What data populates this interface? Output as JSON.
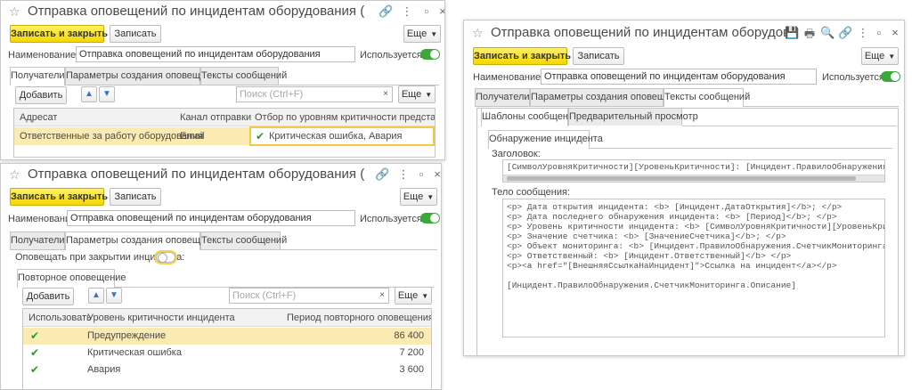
{
  "win1": {
    "title": "Отправка оповещений по инцидентам оборудования (Настройк...",
    "save_close": "Записать и закрыть",
    "save": "Записать",
    "more": "Еще",
    "name_label": "Наименование:",
    "name_value": "Отправка оповещений по инцидентам оборудования",
    "used_label": "Используется:",
    "tabs": [
      "Получатели",
      "Параметры создания оповещения",
      "Тексты сообщений"
    ],
    "add": "Добавить",
    "search_placeholder": "Поиск (Ctrl+F)",
    "more2": "Еще",
    "columns": [
      "Адресат",
      "Канал отправки",
      "Отбор по уровням критичности представление"
    ],
    "rows": [
      {
        "recipient": "Ответственные за работу оборудования",
        "channel": "Email",
        "filter": "Критическая ошибка, Авария"
      }
    ]
  },
  "win2": {
    "title": "Отправка оповещений по инцидентам оборудования (Настройк...",
    "save_close": "Записать и закрыть",
    "save": "Записать",
    "more": "Еще",
    "name_label": "Наименование:",
    "name_value": "Отправка оповещений по инцидентам оборудования",
    "used_label": "Используется:",
    "tabs": [
      "Получатели",
      "Параметры создания оповещения",
      "Тексты сообщений"
    ],
    "notify_close_label": "Оповещать при закрытии инцидента:",
    "subtab": "Повторное оповещение",
    "add": "Добавить",
    "search_placeholder": "Поиск (Ctrl+F)",
    "more2": "Еще",
    "columns": [
      "Использовать",
      "Уровень критичности инцидента",
      "Период повторного оповещения, сек."
    ],
    "rows": [
      {
        "level": "Предупреждение",
        "period": "86 400"
      },
      {
        "level": "Критическая ошибка",
        "period": "7 200"
      },
      {
        "level": "Авария",
        "period": "3 600"
      }
    ]
  },
  "win3": {
    "title": "Отправка оповещений по инцидентам оборудования (...",
    "save_close": "Записать и закрыть",
    "save": "Записать",
    "more": "Еще",
    "name_label": "Наименование:",
    "name_value": "Отправка оповещений по инцидентам оборудования",
    "used_label": "Используется:",
    "tabs": [
      "Получатели",
      "Параметры создания оповещения",
      "Тексты сообщений"
    ],
    "subtabs": [
      "Шаблоны сообщений",
      "Предварительный просмотр"
    ],
    "template_tab": "Обнаружение инцидента",
    "header_label": "Заголовок:",
    "header_text": "[СимволУровняКритичности][УровеньКритичности]: [Инцидент.ПравилоОбнаружения.Сч",
    "body_label": "Тело сообщения:",
    "body_lines": [
      "<p> Дата открытия инцидента: <b> [Инцидент.ДатаОткрытия]</b>; </p>",
      "<p> Дата последнего обнаружения инцидента: <b> [Период]</b>; </p>",
      "<p> Уровень критичности инцидента: <b> [СимволУровняКритичности][УровеньКритич",
      "<p> Значение счетчика: <b> [ЗначениеСчетчика]</b>; </p>",
      "<p> Объект мониторинга: <b> [Инцидент.ПравилоОбнаружения.СчетчикМониторинга.Об",
      "<p> Ответственный: <b> [Инцидент.Ответственный]</b> </p>",
      "<p><a href=\"[ВнешняяСсылкаНаИнцидент]\">Ссылка на инцидент</a></p>",
      "",
      "[Инцидент.ПравилоОбнаружения.СчетчикМониторинга.Описание]"
    ]
  }
}
